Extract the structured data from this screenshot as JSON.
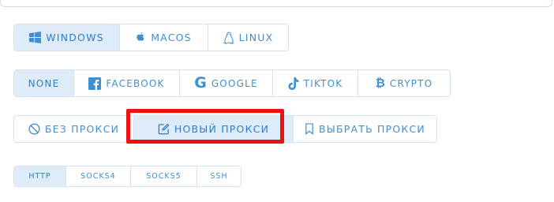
{
  "os_tabs": [
    {
      "label": "WINDOWS",
      "icon": "windows-icon",
      "active": true
    },
    {
      "label": "MACOS",
      "icon": "apple-icon",
      "active": false
    },
    {
      "label": "LINUX",
      "icon": "linux-icon",
      "active": false
    }
  ],
  "profile_tabs": [
    {
      "label": "NONE",
      "active": true
    },
    {
      "label": "FACEBOOK",
      "icon": "facebook-icon",
      "active": false
    },
    {
      "label": "GOOGLE",
      "icon": "google-icon",
      "active": false
    },
    {
      "label": "TIKTOK",
      "icon": "tiktok-icon",
      "active": false
    },
    {
      "label": "CRYPTO",
      "icon": "bitcoin-icon",
      "active": false
    }
  ],
  "proxy_tabs": [
    {
      "label": "БЕЗ ПРОКСИ",
      "icon": "no-proxy-icon",
      "active": false
    },
    {
      "label": "НОВЫЙ ПРОКСИ",
      "icon": "edit-icon",
      "active": true
    },
    {
      "label": "ВЫБРАТЬ ПРОКСИ",
      "icon": "bookmark-icon",
      "active": false
    }
  ],
  "protocol_tabs": [
    {
      "label": "HTTP",
      "active": true
    },
    {
      "label": "SOCKS4",
      "active": false
    },
    {
      "label": "SOCKS5",
      "active": false
    },
    {
      "label": "SSH",
      "active": false
    }
  ],
  "colors": {
    "accent": "#3f8fd2",
    "active_bg": "#deebf8",
    "border": "#d6e2ee",
    "highlight": "#ee1111"
  }
}
